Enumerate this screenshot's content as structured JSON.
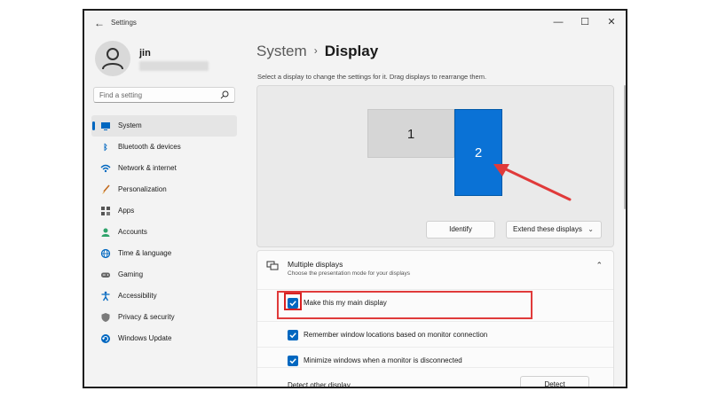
{
  "window": {
    "title": "Settings",
    "controls": {
      "minimize": "—",
      "maximize": "☐",
      "close": "✕"
    }
  },
  "user": {
    "name": "jin"
  },
  "search": {
    "placeholder": "Find a setting",
    "icon": "search-icon"
  },
  "sidebar": {
    "items": [
      {
        "label": "System",
        "icon": "monitor-icon",
        "active": true
      },
      {
        "label": "Bluetooth & devices",
        "icon": "bluetooth-icon"
      },
      {
        "label": "Network & internet",
        "icon": "wifi-icon"
      },
      {
        "label": "Personalization",
        "icon": "brush-icon"
      },
      {
        "label": "Apps",
        "icon": "apps-icon"
      },
      {
        "label": "Accounts",
        "icon": "person-icon"
      },
      {
        "label": "Time & language",
        "icon": "globe-icon"
      },
      {
        "label": "Gaming",
        "icon": "gamepad-icon"
      },
      {
        "label": "Accessibility",
        "icon": "accessibility-icon"
      },
      {
        "label": "Privacy & security",
        "icon": "shield-icon"
      },
      {
        "label": "Windows Update",
        "icon": "update-icon"
      }
    ]
  },
  "header": {
    "parent": "System",
    "separator": "›",
    "current": "Display"
  },
  "instruction": "Select a display to change the settings for it. Drag displays to rearrange them.",
  "displays": {
    "monitor1": "1",
    "monitor2": "2",
    "identify_label": "Identify",
    "mode_selected": "Extend these displays",
    "accent": "#0a72d6"
  },
  "multiple_displays": {
    "title": "Multiple displays",
    "subtitle": "Choose the presentation mode for your displays",
    "options": [
      {
        "label": "Make this my main display",
        "checked": true
      },
      {
        "label": "Remember window locations based on monitor connection",
        "checked": true
      },
      {
        "label": "Minimize windows when a monitor is disconnected",
        "checked": true
      }
    ],
    "detect_label": "Detect other display",
    "detect_button": "Detect"
  },
  "colors": {
    "accent": "#0067c0",
    "annotation_red": "#e03a3a"
  }
}
